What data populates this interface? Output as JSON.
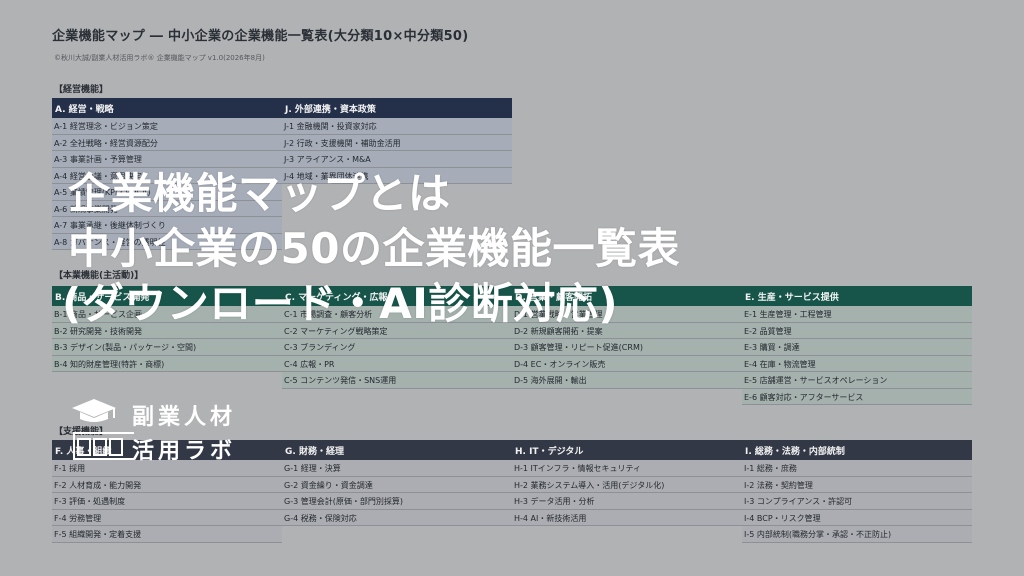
{
  "title": "企業機能マップ ― 中小企業の企業機能一覧表(大分類10×中分類50)",
  "credit": "©秋川大誠/副業人材活用ラボ® 企業機能マップ v1.0(2026年8月)",
  "sections": {
    "management": "【経営機能】",
    "core": "【本業機能(主活動)】",
    "support": "【支援機能】"
  },
  "columns": {
    "A": {
      "head": "A. 経営・戦略",
      "items": [
        "A-1 経営理念・ビジョン策定",
        "A-2 全社戦略・経営資源配分",
        "A-3 事業計画・予算管理",
        "A-4 経営会議・意思決定",
        "A-5 業績管理(KPI・PDCA)",
        "A-6 新規事業開発",
        "A-7 事業承継・後継体制づくり",
        "A-8 ガバナンス・経営の透明性"
      ]
    },
    "J": {
      "head": "J. 外部連携・資本政策",
      "items": [
        "J-1 金融機関・投資家対応",
        "J-2 行政・支援機関・補助金活用",
        "J-3 アライアンス・M&A",
        "J-4 地域・業界団体連携"
      ]
    },
    "B": {
      "head": "B. 商品・サービス開発",
      "items": [
        "B-1 商品・サービス企画",
        "B-2 研究開発・技術開発",
        "B-3 デザイン(製品・パッケージ・空間)",
        "B-4 知的財産管理(特許・商標)"
      ]
    },
    "C": {
      "head": "C. マーケティング・広報",
      "items": [
        "C-1 市場調査・顧客分析",
        "C-2 マーケティング戦略策定",
        "C-3 ブランディング",
        "C-4 広報・PR",
        "C-5 コンテンツ発信・SNS運用"
      ]
    },
    "D": {
      "head": "D. 営業・顧客開拓",
      "items": [
        "D-1 営業戦略・営業管理",
        "D-2 新規顧客開拓・提案",
        "D-3 顧客管理・リピート促進(CRM)",
        "D-4 EC・オンライン販売",
        "D-5 海外展開・輸出"
      ]
    },
    "E": {
      "head": "E. 生産・サービス提供",
      "items": [
        "E-1 生産管理・工程管理",
        "E-2 品質管理",
        "E-3 購買・調達",
        "E-4 在庫・物流管理",
        "E-5 店舗運営・サービスオペレーション",
        "E-6 顧客対応・アフターサービス"
      ]
    },
    "F": {
      "head": "F. 人事・組織",
      "items": [
        "F-1 採用",
        "F-2 人材育成・能力開発",
        "F-3 評価・処遇制度",
        "F-4 労務管理",
        "F-5 組織開発・定着支援"
      ]
    },
    "G": {
      "head": "G. 財務・経理",
      "items": [
        "G-1 経理・決算",
        "G-2 資金繰り・資金調達",
        "G-3 管理会計(原価・部門別採算)",
        "G-4 税務・保険対応"
      ]
    },
    "H": {
      "head": "H. IT・デジタル",
      "items": [
        "H-1 ITインフラ・情報セキュリティ",
        "H-2 業務システム導入・活用(デジタル化)",
        "H-3 データ活用・分析",
        "H-4 AI・新技術活用"
      ]
    },
    "I": {
      "head": "I. 総務・法務・内部統制",
      "items": [
        "I-1 総務・庶務",
        "I-2 法務・契約管理",
        "I-3 コンプライアンス・許認可",
        "I-4 BCP・リスク管理",
        "I-5 内部統制(職務分掌・承認・不正防止)"
      ]
    }
  },
  "overlay": {
    "line1": "企業機能マップとは",
    "line2": "中小企業の50の企業機能一覧表",
    "line3": "(ダウンロード・AI診断対応)"
  },
  "logo": {
    "line1": "副業人材",
    "line2": "活用ラボ"
  },
  "colors": {
    "navy": "#24304a",
    "green": "#17554a",
    "slate": "#333846"
  }
}
